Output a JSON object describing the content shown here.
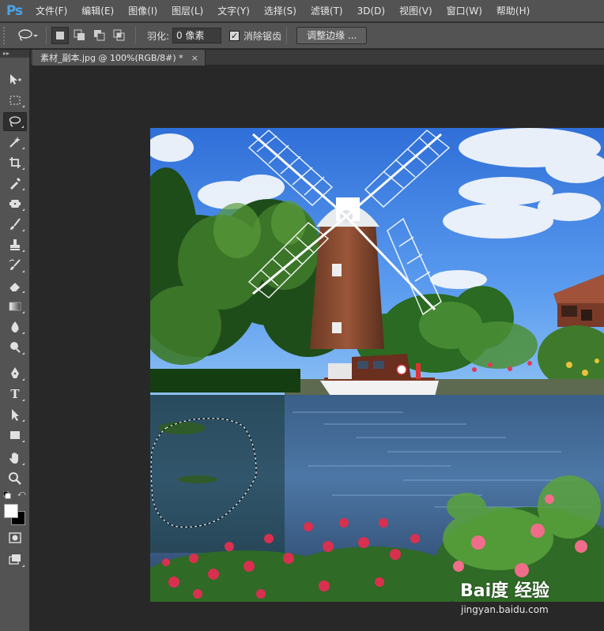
{
  "app": {
    "logo": "Ps"
  },
  "menu": [
    "文件(F)",
    "编辑(E)",
    "图像(I)",
    "图层(L)",
    "文字(Y)",
    "选择(S)",
    "滤镜(T)",
    "3D(D)",
    "视图(V)",
    "窗口(W)",
    "帮助(H)"
  ],
  "options": {
    "tool_icon": "lasso-icon",
    "selection_modes": [
      "new-selection-icon",
      "add-to-selection-icon",
      "subtract-from-selection-icon",
      "intersect-selection-icon"
    ],
    "feather_label": "羽化:",
    "feather_value": "0 像素",
    "antialias_label": "消除锯齿",
    "antialias_checked": true,
    "refine_edge_label": "调整边缘 ..."
  },
  "document": {
    "tab_title": "素材_副本.jpg @ 100%(RGB/8#) *",
    "close_glyph": "×"
  },
  "tools": [
    {
      "name": "move-tool-icon"
    },
    {
      "name": "rect-marquee-icon"
    },
    {
      "name": "lasso-icon",
      "active": true
    },
    {
      "name": "magic-wand-icon"
    },
    {
      "name": "crop-icon"
    },
    {
      "name": "eyedropper-icon"
    },
    {
      "name": "healing-brush-icon"
    },
    {
      "name": "brush-icon"
    },
    {
      "name": "clone-stamp-icon"
    },
    {
      "name": "history-brush-icon"
    },
    {
      "name": "eraser-icon"
    },
    {
      "name": "gradient-icon"
    },
    {
      "name": "blur-icon"
    },
    {
      "name": "dodge-icon"
    },
    {
      "name": "pen-icon"
    },
    {
      "name": "type-tool-icon",
      "glyph": "T"
    },
    {
      "name": "path-select-icon"
    },
    {
      "name": "rectangle-shape-icon"
    },
    {
      "name": "hand-icon"
    },
    {
      "name": "zoom-icon"
    },
    {
      "name": "quick-mask-icon"
    },
    {
      "name": "screen-mode-icon"
    }
  ],
  "colors": {
    "foreground": "#ffffff",
    "background": "#000000",
    "ui_panel": "#535353",
    "canvas_bg": "#282828",
    "ps_blue": "#4aa3e8"
  },
  "watermark": {
    "logo": "Bai度 经验",
    "url": "jingyan.baidu.com"
  }
}
